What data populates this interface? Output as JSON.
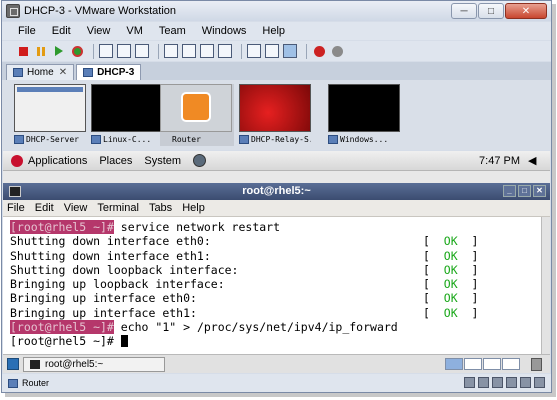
{
  "window": {
    "title": "DHCP-3 - VMware Workstation"
  },
  "menubar": [
    "File",
    "Edit",
    "View",
    "VM",
    "Team",
    "Windows",
    "Help"
  ],
  "tabs": [
    {
      "label": "Home"
    },
    {
      "label": "DHCP-3"
    }
  ],
  "thumbnails": [
    {
      "label": "DHCP-Server",
      "screen": "#f0f0f0"
    },
    {
      "label": "Linux-C...",
      "screen": "#000000"
    },
    {
      "label": "Router",
      "screen": "#d9d9d9"
    },
    {
      "label": "DHCP-Relay-S...",
      "screen": "#b01212"
    },
    {
      "label": "Windows...",
      "screen": "#000000"
    }
  ],
  "gnome_panel": {
    "menus": [
      "Applications",
      "Places",
      "System"
    ],
    "clock": "7:47 PM"
  },
  "terminal": {
    "title": "root@rhel5:~",
    "menu": [
      "File",
      "Edit",
      "View",
      "Terminal",
      "Tabs",
      "Help"
    ],
    "lines": [
      {
        "prompt": "[root@rhel5 ~]#",
        "text": " service network restart"
      },
      {
        "text": "Shutting down interface eth0:",
        "status": "OK"
      },
      {
        "text": "Shutting down interface eth1:",
        "status": "OK"
      },
      {
        "text": "Shutting down loopback interface:",
        "status": "OK"
      },
      {
        "text": "Bringing up loopback interface:",
        "status": "OK"
      },
      {
        "text": "Bringing up interface eth0:",
        "status": "OK"
      },
      {
        "text": "Bringing up interface eth1:",
        "status": "OK"
      },
      {
        "prompt": "[root@rhel5 ~]#",
        "text": " echo \"1\" > /proc/sys/net/ipv4/ip_forward"
      },
      {
        "plain_prompt": "[root@rhel5 ~]#",
        "text": " "
      }
    ]
  },
  "taskbar": {
    "task_label": "root@rhel5:~"
  },
  "statusbar": {
    "label": "Router"
  }
}
